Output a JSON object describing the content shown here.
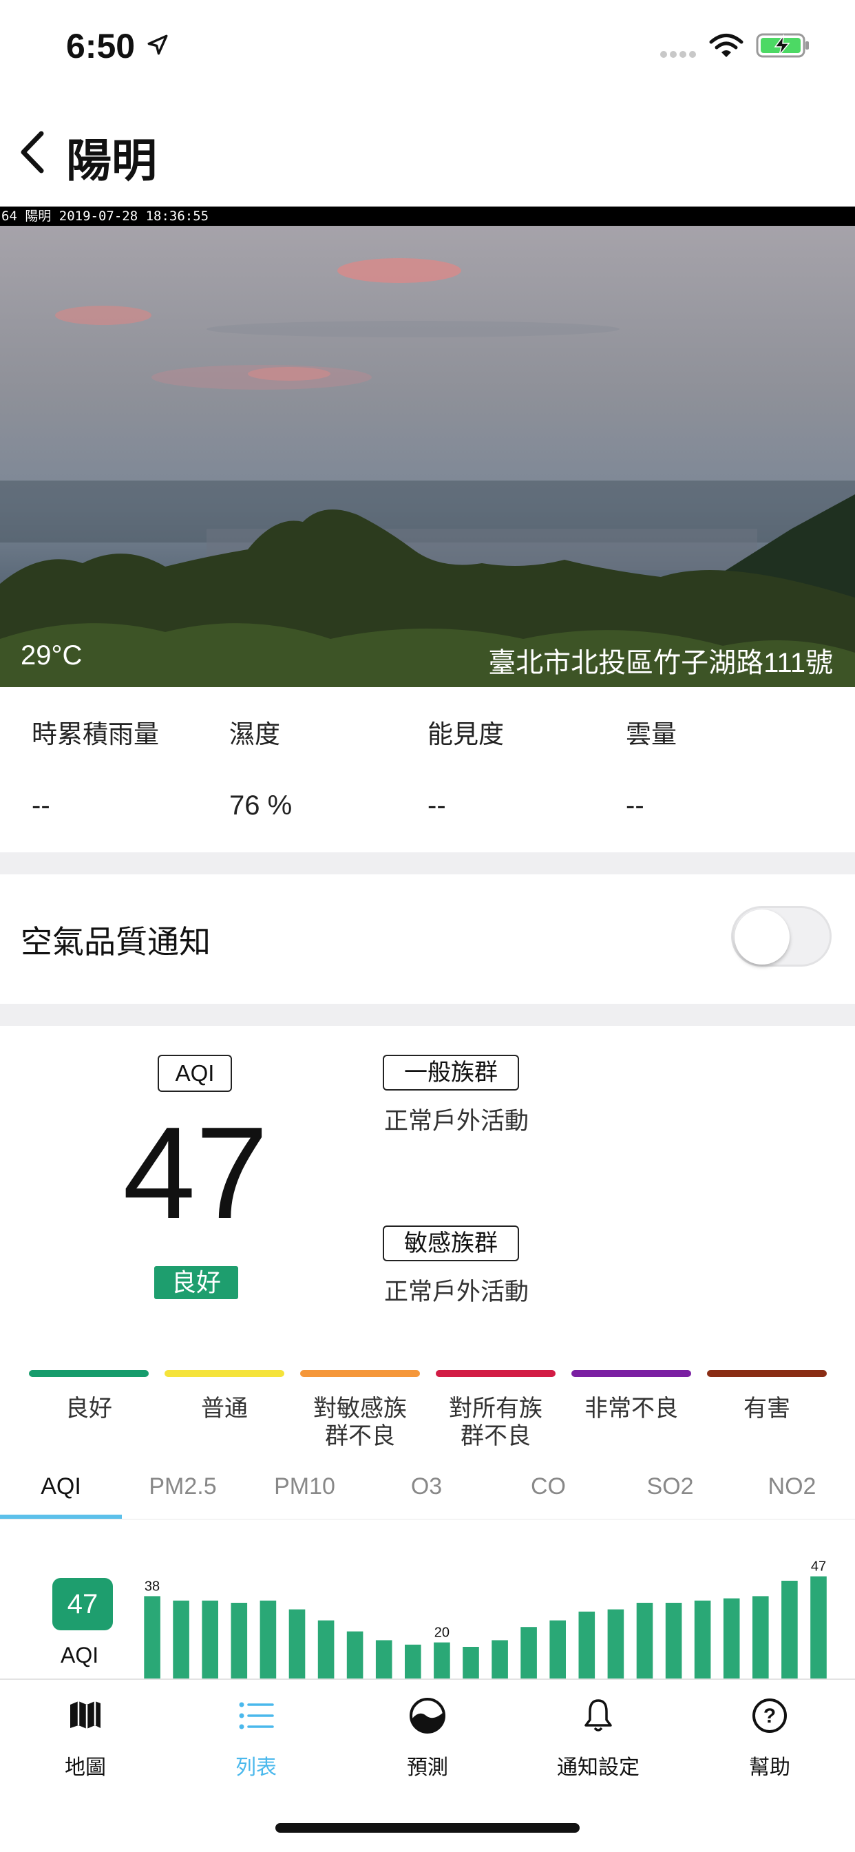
{
  "status_bar": {
    "time": "6:50",
    "icons": [
      "location-arrow-icon",
      "signal-dots-icon",
      "wifi-icon",
      "battery-charging-icon"
    ],
    "battery_color": "#4cd964"
  },
  "nav": {
    "back_icon": "chevron-left-icon",
    "title": "陽明"
  },
  "camera": {
    "overlay_stamp": "64 陽明 2019-07-28 18:36:55",
    "temperature": "29°C",
    "address": "臺北市北投區竹子湖路111號"
  },
  "stats": [
    {
      "label": "時累積雨量",
      "value": "--"
    },
    {
      "label": "濕度",
      "value": "76 %"
    },
    {
      "label": "能見度",
      "value": "--"
    },
    {
      "label": "雲量",
      "value": "--"
    }
  ],
  "notify": {
    "label": "空氣品質通知",
    "toggle_on": false
  },
  "aqi": {
    "box_label": "AQI",
    "value": "47",
    "status": "良好",
    "status_color": "#1e9e6e",
    "groups": [
      {
        "name": "一般族群",
        "advice": "正常戶外活動"
      },
      {
        "name": "敏感族群",
        "advice": "正常戶外活動"
      }
    ]
  },
  "legend": [
    {
      "label": "良好",
      "color": "#169c6c"
    },
    {
      "label": "普通",
      "color": "#f5e33b"
    },
    {
      "label": "對敏感族\n群不良",
      "color": "#f5973a"
    },
    {
      "label": "對所有族\n群不良",
      "color": "#d21c45"
    },
    {
      "label": "非常不良",
      "color": "#7a1fa2"
    },
    {
      "label": "有害",
      "color": "#8a2d14"
    }
  ],
  "pollutant_tabs": {
    "items": [
      "AQI",
      "PM2.5",
      "PM10",
      "O3",
      "CO",
      "SO2",
      "NO2"
    ],
    "active_index": 0,
    "underline_color": "#5cc0ea"
  },
  "chart_data": {
    "type": "bar",
    "badge_value": "47",
    "badge_label": "AQI",
    "color": "#2aa876",
    "values": [
      38,
      36,
      36,
      35,
      36,
      32,
      27,
      22,
      18,
      16,
      17,
      15,
      18,
      24,
      27,
      31,
      32,
      35,
      35,
      36,
      37,
      38,
      45,
      47
    ],
    "labels": [
      {
        "index": 0,
        "text": "38"
      },
      {
        "index": 10,
        "text": "20"
      },
      {
        "index": 23,
        "text": "47"
      }
    ]
  },
  "tab_bar": {
    "items": [
      {
        "label": "地圖",
        "icon": "map-icon",
        "active": false
      },
      {
        "label": "列表",
        "icon": "list-icon",
        "active": true
      },
      {
        "label": "預測",
        "icon": "forecast-icon",
        "active": false
      },
      {
        "label": "通知設定",
        "icon": "bell-icon",
        "active": false
      },
      {
        "label": "幫助",
        "icon": "help-icon",
        "active": false
      }
    ],
    "active_color": "#4ab8ec"
  }
}
